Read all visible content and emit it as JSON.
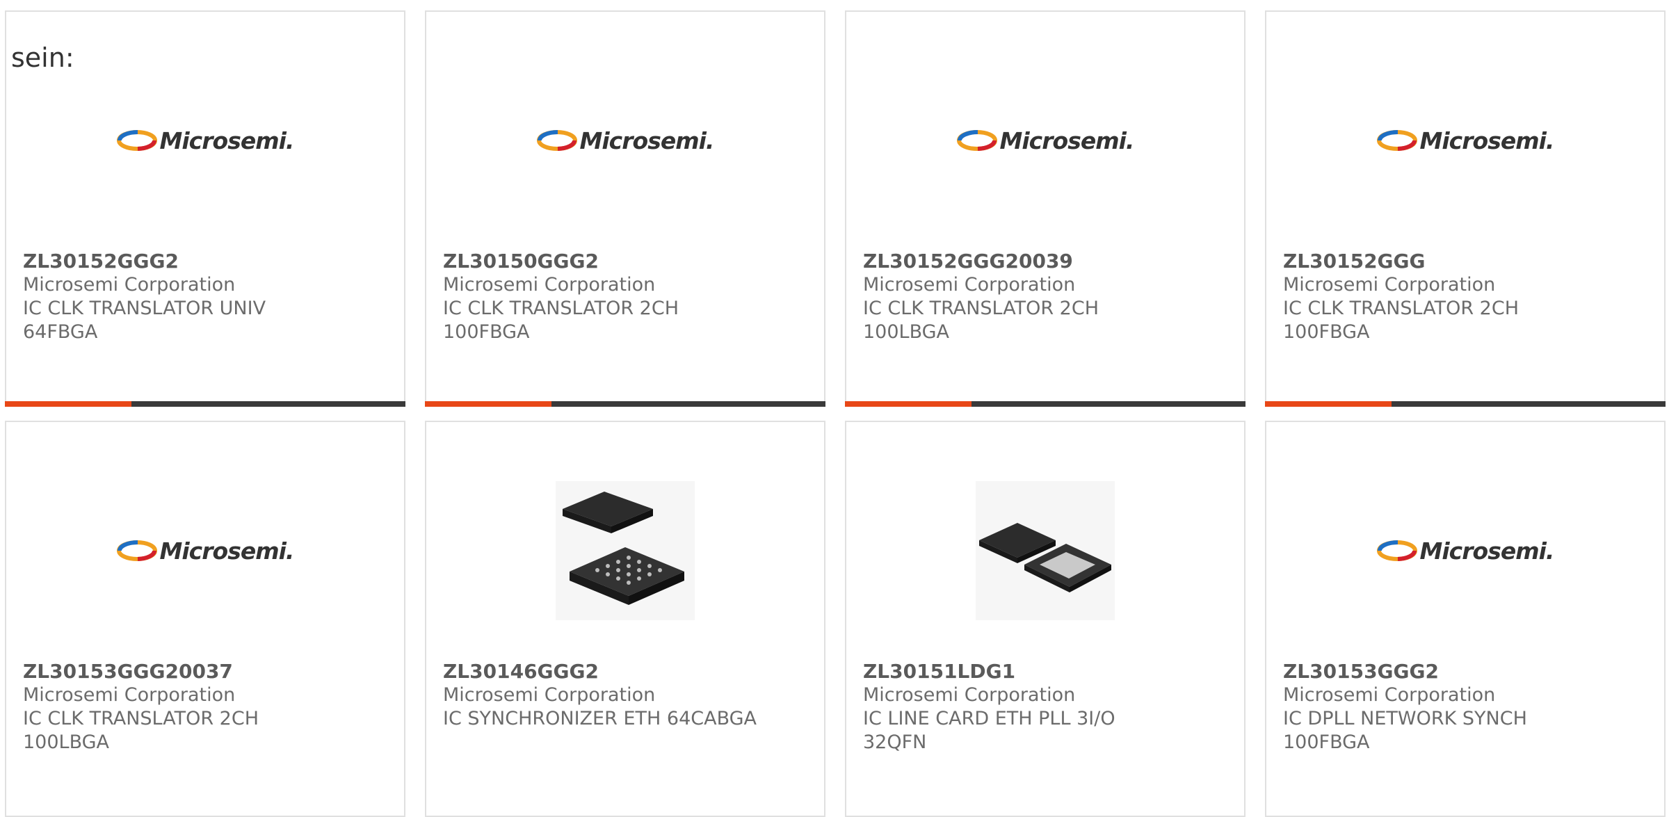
{
  "intro_text": "sein:",
  "brand_logo_text": "Microsemi.",
  "accent_color": "#e84717",
  "products": [
    {
      "part": "ZL30152GGG2",
      "maker": "Microsemi Corporation",
      "desc1": "IC CLK TRANSLATOR UNIV",
      "desc2": "64FBGA",
      "image": "microsemi-logo"
    },
    {
      "part": "ZL30150GGG2",
      "maker": "Microsemi Corporation",
      "desc1": "IC CLK TRANSLATOR 2CH",
      "desc2": "100FBGA",
      "image": "microsemi-logo"
    },
    {
      "part": "ZL30152GGG20039",
      "maker": "Microsemi Corporation",
      "desc1": "IC CLK TRANSLATOR 2CH",
      "desc2": "100LBGA",
      "image": "microsemi-logo"
    },
    {
      "part": "ZL30152GGG",
      "maker": "Microsemi Corporation",
      "desc1": "IC CLK TRANSLATOR 2CH",
      "desc2": "100FBGA",
      "image": "microsemi-logo"
    },
    {
      "part": "ZL30153GGG20037",
      "maker": "Microsemi Corporation",
      "desc1": "IC CLK TRANSLATOR 2CH",
      "desc2": "100LBGA",
      "image": "microsemi-logo"
    },
    {
      "part": "ZL30146GGG2",
      "maker": "Microsemi Corporation",
      "desc1": "IC SYNCHRONIZER ETH 64CABGA",
      "desc2": "",
      "image": "bga-chip-photo"
    },
    {
      "part": "ZL30151LDG1",
      "maker": "Microsemi Corporation",
      "desc1": "IC LINE CARD ETH PLL 3I/O",
      "desc2": "32QFN",
      "image": "qfn-chip-photo"
    },
    {
      "part": "ZL30153GGG2",
      "maker": "Microsemi Corporation",
      "desc1": "IC DPLL NETWORK SYNCH",
      "desc2": "100FBGA",
      "image": "microsemi-logo"
    }
  ]
}
